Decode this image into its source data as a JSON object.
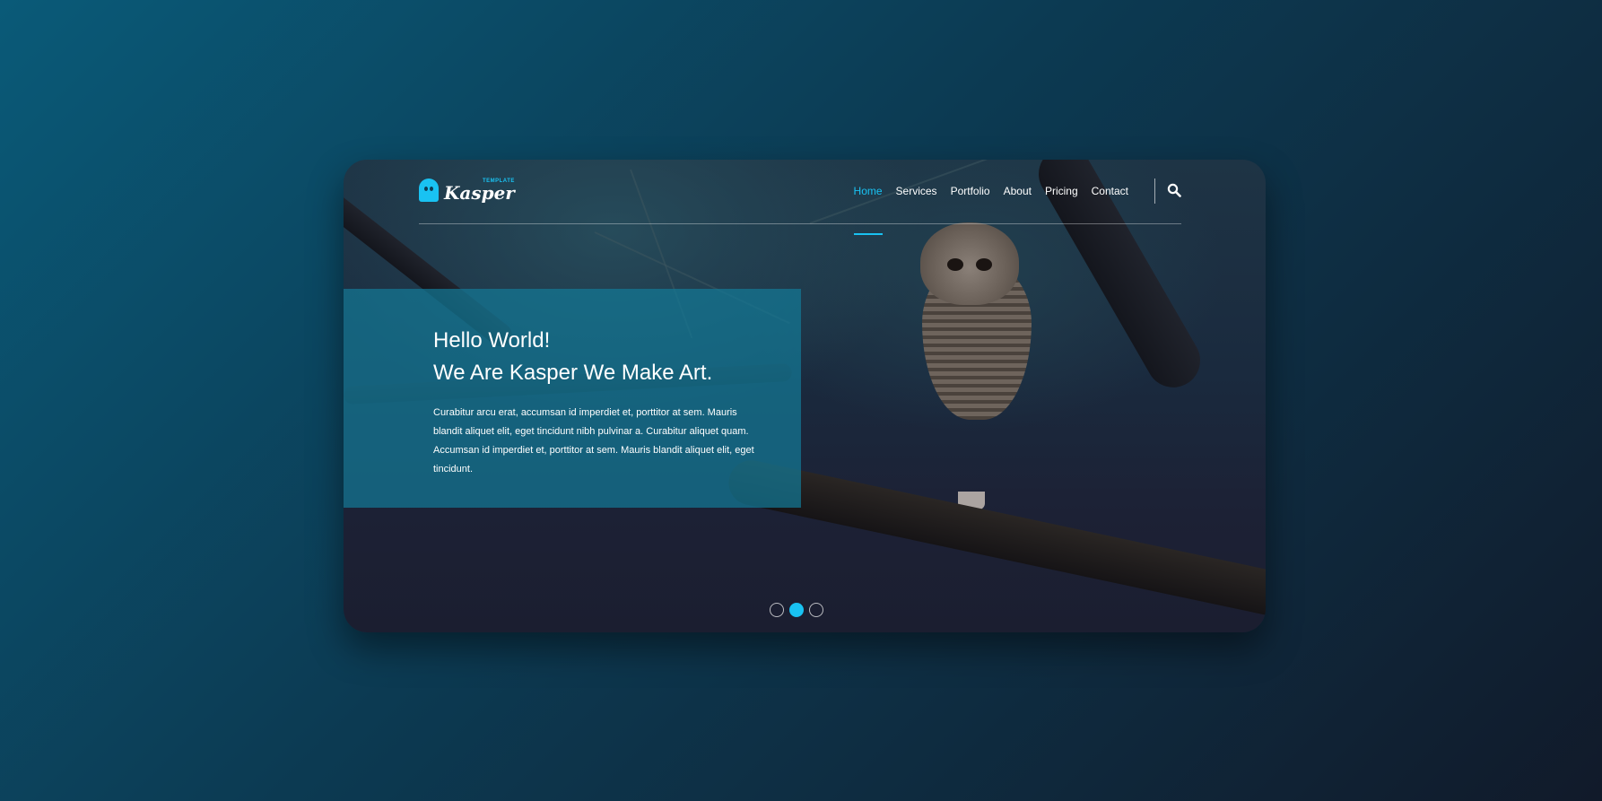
{
  "header": {
    "logo": {
      "small_text": "TEMPLATE",
      "main_text": "Kasper",
      "icon": "ghost-icon"
    },
    "nav": [
      {
        "label": "Home",
        "active": true
      },
      {
        "label": "Services",
        "active": false
      },
      {
        "label": "Portfolio",
        "active": false
      },
      {
        "label": "About",
        "active": false
      },
      {
        "label": "Pricing",
        "active": false
      },
      {
        "label": "Contact",
        "active": false
      }
    ],
    "search_icon": "search-icon"
  },
  "hero": {
    "title_line1": "Hello World!",
    "title_line2": "We Are Kasper We Make Art.",
    "body": "Curabitur arcu erat, accumsan id imperdiet et, porttitor at sem. Mauris blandit aliquet elit, eget tincidunt nibh pulvinar a. Curabitur aliquet quam. Accumsan id imperdiet et, porttitor at sem. Mauris blandit aliquet elit, eget tincidunt."
  },
  "slider": {
    "dots": 3,
    "active_index": 1
  },
  "colors": {
    "accent": "#19c2f2",
    "panel": "#14789a",
    "text": "#ffffff"
  }
}
